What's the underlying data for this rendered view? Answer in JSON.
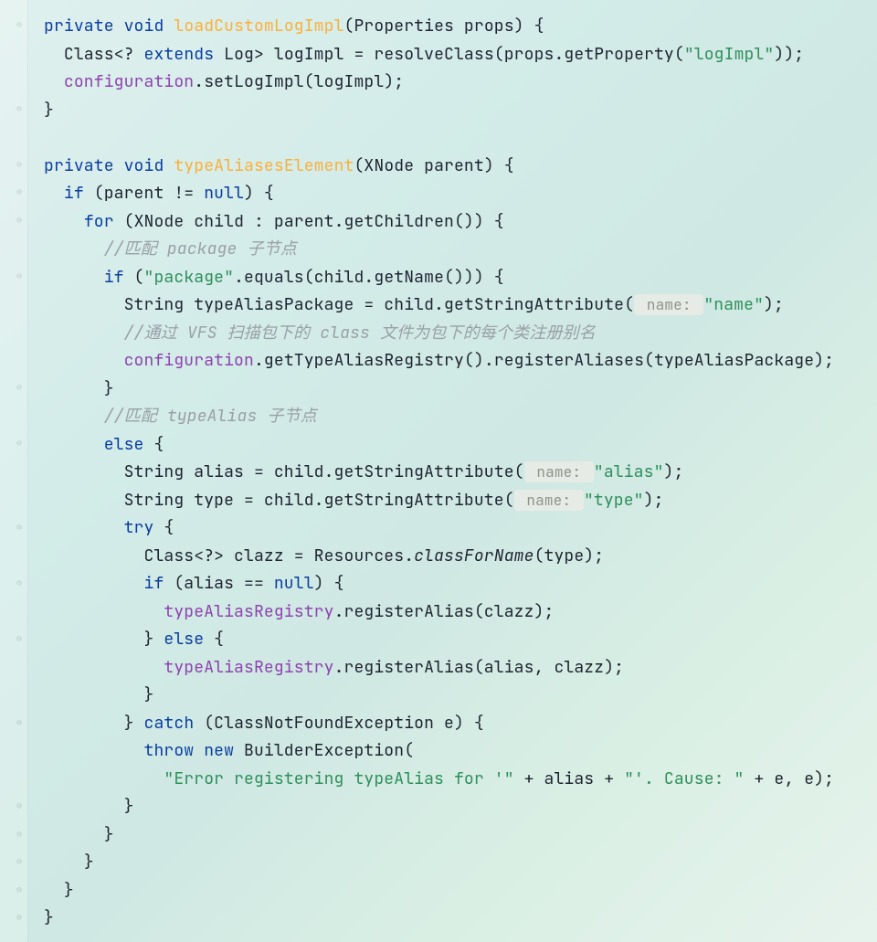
{
  "code": {
    "m1": {
      "kw_private": "private",
      "kw_void": "void",
      "name": "loadCustomLogImpl",
      "sig_open": "(Properties props) {",
      "l2a": "Class<? ",
      "kw_extends": "extends",
      "l2b": " Log> logImpl = resolveClass(props.getProperty(",
      "str_logImpl": "\"logImpl\"",
      "l2c": "));",
      "l3_field": "configuration",
      "l3_rest": ".setLogImpl(logImpl);",
      "l4": "}"
    },
    "m2": {
      "kw_private": "private",
      "kw_void": "void",
      "name": "typeAliasesElement",
      "sig_open": "(XNode parent) {",
      "if_kw": "if",
      "if_cond_a": " (parent != ",
      "null_kw": "null",
      "if_cond_b": ") {",
      "for_kw": "for",
      "for_cond": " (XNode child : parent.getChildren()) {",
      "cmt1": "//匹配 package 子节点",
      "if2_kw": "if",
      "if2_a": " (",
      "str_package": "\"package\"",
      "if2_b": ".equals(child.getName())) {",
      "l_pkg_a": "String typeAliasPackage = child.getStringAttribute(",
      "hint_name": " name: ",
      "str_name": "\"name\"",
      "l_pkg_b": ");",
      "cmt2": "//通过 VFS 扫描包下的 class 文件为包下的每个类注册别名",
      "cfg_field": "configuration",
      "l_reg": ".getTypeAliasRegistry().registerAliases(typeAliasPackage);",
      "close1": "}",
      "cmt3": "//匹配 typeAlias 子节点",
      "else_kw": "else",
      "else_open": " {",
      "alias_a": "String alias = child.getStringAttribute(",
      "str_alias": "\"alias\"",
      "alias_b": ");",
      "type_a": "String type = child.getStringAttribute(",
      "str_type": "\"type\"",
      "type_b": ");",
      "try_kw": "try",
      "try_open": " {",
      "clazz_line_a": "Class<?> clazz = Resources.",
      "clazz_line_m": "classForName",
      "clazz_line_b": "(type);",
      "if3_kw": "if",
      "if3_a": " (alias == ",
      "if3_b": ") {",
      "tar_field": "typeAliasRegistry",
      "reg1": ".registerAlias(clazz);",
      "close_if3": "} ",
      "else2_kw": "else",
      "else2_open": " {",
      "reg2": ".registerAlias(alias, clazz);",
      "close_else2": "}",
      "close_try": "} ",
      "catch_kw": "catch",
      "catch_sig": " (ClassNotFoundException e) {",
      "throw_kw": "throw",
      "new_kw": "new",
      "bex": " BuilderException(",
      "err_str1": "\"Error registering typeAlias for '\"",
      "err_mid1": " + alias + ",
      "err_str2": "\"'. Cause: \"",
      "err_mid2": " + e, e);",
      "close_catch": "}",
      "close_else": "}",
      "close_for": "}",
      "close_if": "}",
      "close_method": "}"
    }
  }
}
